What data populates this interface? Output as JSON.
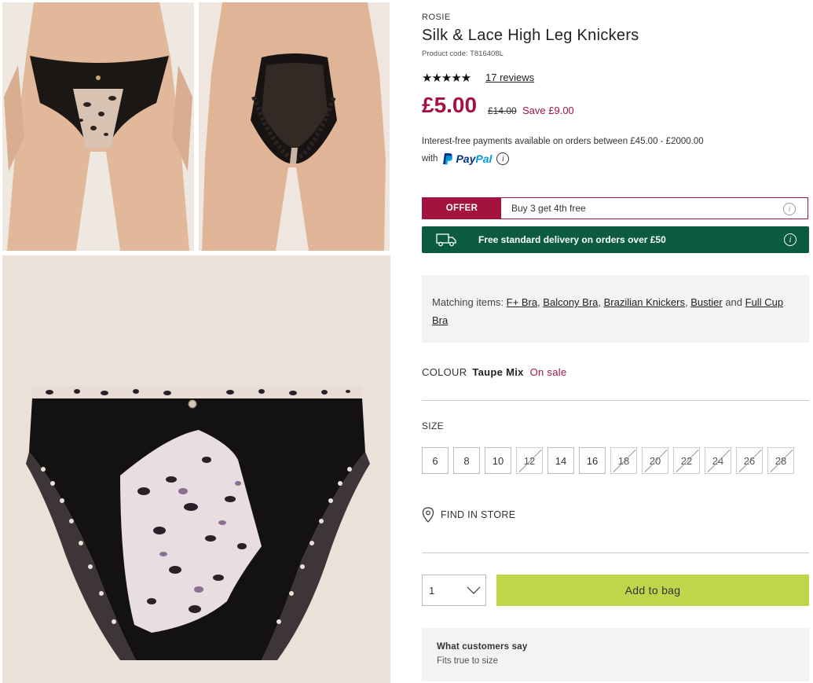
{
  "gallery": {
    "images": [
      {
        "name": "model-front-photo"
      },
      {
        "name": "model-back-photo"
      },
      {
        "name": "product-flat-photo"
      }
    ]
  },
  "product": {
    "brand": "ROSIE",
    "title": "Silk & Lace High Leg Knickers",
    "code": "Product code: T816408L",
    "rating_stars": "★★★★★",
    "rating": 5,
    "reviews": "17 reviews",
    "price": "£5.00",
    "was_price": "£14.00",
    "save": "Save £9.00"
  },
  "payment": {
    "interest_text": "Interest-free payments available on orders between £45.00 - £2000.00",
    "with_text": "with",
    "paypal_a": "Pay",
    "paypal_b": "Pal",
    "info_glyph": "i"
  },
  "offer": {
    "tag": "OFFER",
    "text": "Buy 3 get 4th free"
  },
  "delivery": {
    "text": "Free standard delivery on orders over £50",
    "icon": "truck-icon"
  },
  "matching": {
    "label": "Matching items:",
    "items": [
      "F+ Bra",
      "Balcony Bra",
      "Brazilian Knickers",
      "Bustier",
      "Full Cup Bra"
    ],
    "sep": ",",
    "and": "and"
  },
  "colour": {
    "label": "COLOUR",
    "value": "Taupe Mix",
    "status": "On sale"
  },
  "size": {
    "label": "SIZE",
    "options": [
      {
        "label": "6",
        "available": true
      },
      {
        "label": "8",
        "available": true
      },
      {
        "label": "10",
        "available": true
      },
      {
        "label": "12",
        "available": false
      },
      {
        "label": "14",
        "available": true
      },
      {
        "label": "16",
        "available": true
      },
      {
        "label": "18",
        "available": false
      },
      {
        "label": "20",
        "available": false
      },
      {
        "label": "22",
        "available": false
      },
      {
        "label": "24",
        "available": false
      },
      {
        "label": "26",
        "available": false
      },
      {
        "label": "28",
        "available": false
      }
    ]
  },
  "store": {
    "label": "FIND IN STORE",
    "icon": "location-pin-icon"
  },
  "purchase": {
    "quantity": "1",
    "add_label": "Add to bag"
  },
  "customers": {
    "heading": "What customers say",
    "text": "Fits true to size"
  },
  "colors": {
    "sale_red": "#a4123f",
    "delivery_green": "#0b5c3e",
    "add_button": "#bfd64b"
  }
}
